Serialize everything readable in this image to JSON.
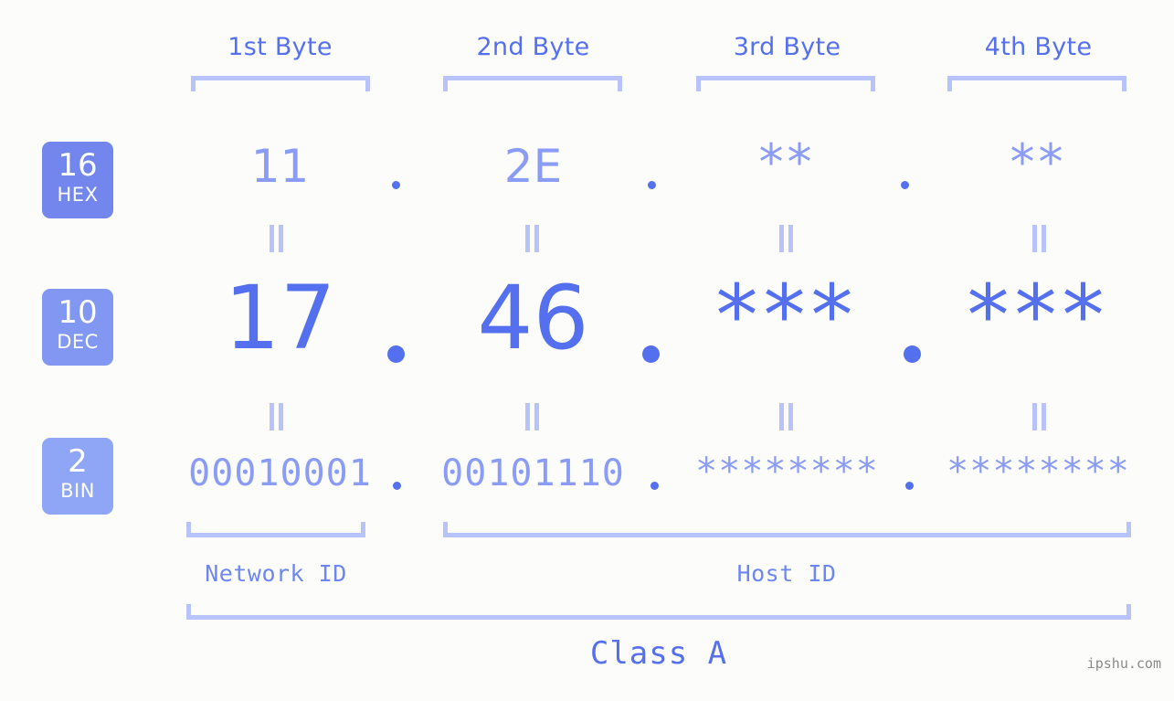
{
  "watermark": "ipshu.com",
  "colors": {
    "background": "#fcfdfa",
    "accent_strong": "#5570ef",
    "accent_light": "#8a9cf5",
    "bracket": "#b8c2fb",
    "badge_hex": "#7286ee",
    "badge_dec": "#8197f2",
    "badge_bin": "#8fa6f7",
    "watermark_text": "#8a8a8a"
  },
  "byte_headers": [
    {
      "label": "1st Byte"
    },
    {
      "label": "2nd Byte"
    },
    {
      "label": "3rd Byte"
    },
    {
      "label": "4th Byte"
    }
  ],
  "bases": [
    {
      "id": "hex",
      "number": "16",
      "name": "HEX"
    },
    {
      "id": "dec",
      "number": "10",
      "name": "DEC"
    },
    {
      "id": "bin",
      "number": "2",
      "name": "BIN"
    }
  ],
  "rows": {
    "hex": {
      "values": [
        "11",
        "2E",
        "**",
        "**"
      ],
      "separator": "."
    },
    "dec": {
      "values": [
        "17",
        "46",
        "***",
        "***"
      ],
      "separator": "."
    },
    "bin": {
      "values": [
        "00010001",
        "00101110",
        "********",
        "********"
      ],
      "separator": "."
    }
  },
  "equals_symbol": "||",
  "segments": [
    {
      "id": "network",
      "label": "Network ID"
    },
    {
      "id": "host",
      "label": "Host ID"
    }
  ],
  "class": {
    "label": "Class A"
  }
}
